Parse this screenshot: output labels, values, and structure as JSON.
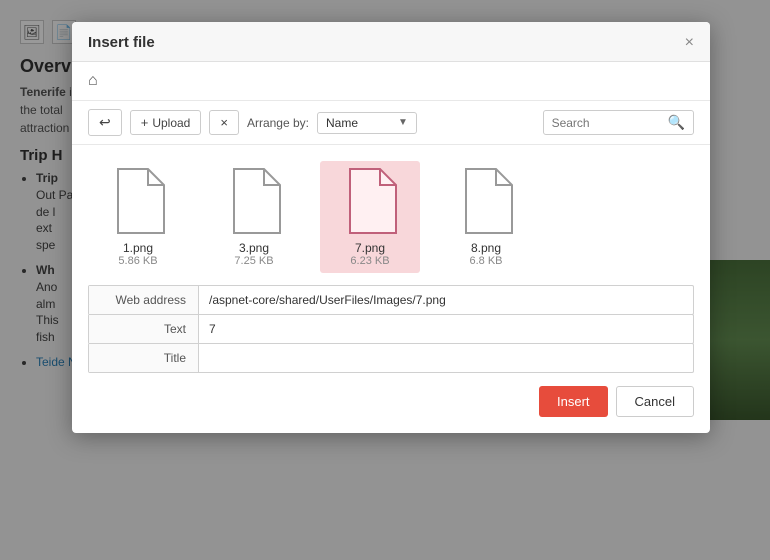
{
  "background": {
    "toolbar_icons": [
      "image-icon",
      "file-icon"
    ],
    "heading": "Overv",
    "paragraph1": "Tenerife island of the total attraction",
    "trip_heading": "Trip H",
    "trip_items": [
      {
        "label": "Trip",
        "text": "Out Park de l ext spe",
        "link": null
      },
      {
        "label": "Wh",
        "text": "Ano alm This fish",
        "link": null
      },
      {
        "label": "Teide National Park Stargazing",
        "link": true
      }
    ]
  },
  "modal": {
    "title": "Insert file",
    "close_label": "×",
    "home_icon": "⌂",
    "toolbar": {
      "upload_icon": "+",
      "upload_label": "Upload",
      "clear_icon": "×",
      "arrange_label": "Arrange by:",
      "arrange_value": "Name",
      "search_placeholder": "Search"
    },
    "files": [
      {
        "name": "1.png",
        "size": "5.86 KB",
        "selected": false
      },
      {
        "name": "3.png",
        "size": "7.25 KB",
        "selected": false
      },
      {
        "name": "7.png",
        "size": "6.23 KB",
        "selected": true
      },
      {
        "name": "8.png",
        "size": "6.8 KB",
        "selected": false
      }
    ],
    "info_fields": [
      {
        "label": "Web address",
        "value": "/aspnet-core/shared/UserFiles/Images/7.png"
      },
      {
        "label": "Text",
        "value": "7"
      },
      {
        "label": "Title",
        "value": ""
      }
    ],
    "footer": {
      "insert_label": "Insert",
      "cancel_label": "Cancel"
    }
  }
}
